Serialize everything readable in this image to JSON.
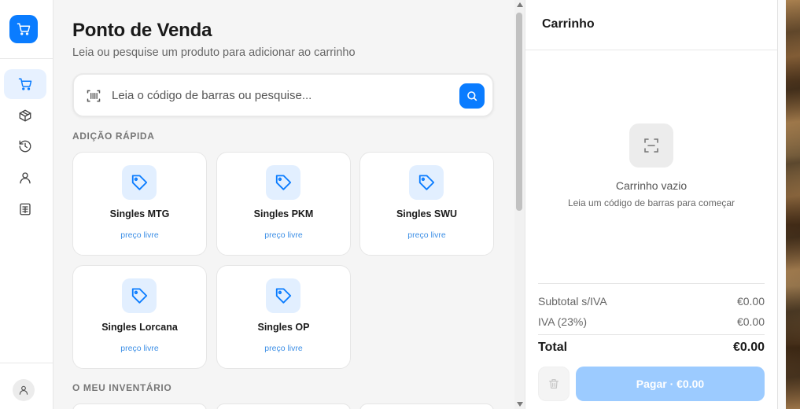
{
  "sidebar": {
    "logo_icon": "cart-icon",
    "nav": [
      {
        "name": "pos",
        "icon": "cart-icon",
        "active": true
      },
      {
        "name": "products",
        "icon": "box-icon",
        "active": false
      },
      {
        "name": "history",
        "icon": "history-icon",
        "active": false
      },
      {
        "name": "customers",
        "icon": "user-icon",
        "active": false
      },
      {
        "name": "reports",
        "icon": "spreadsheet-icon",
        "active": false
      }
    ],
    "user_icon": "user-icon"
  },
  "main": {
    "title": "Ponto de Venda",
    "subtitle": "Leia ou pesquise um produto para adicionar ao carrinho",
    "search": {
      "placeholder": "Leia o código de barras ou pesquise...",
      "value": ""
    },
    "quick_add": {
      "heading": "ADIÇÃO RÁPIDA",
      "items": [
        {
          "name": "Singles MTG",
          "price": "preço livre"
        },
        {
          "name": "Singles PKM",
          "price": "preço livre"
        },
        {
          "name": "Singles SWU",
          "price": "preço livre"
        },
        {
          "name": "Singles Lorcana",
          "price": "preço livre"
        },
        {
          "name": "Singles OP",
          "price": "preço livre"
        }
      ]
    },
    "inventory": {
      "heading": "O MEU INVENTÁRIO"
    }
  },
  "cart": {
    "title": "Carrinho",
    "empty_title": "Carrinho vazio",
    "empty_subtitle": "Leia um código de barras para começar",
    "subtotal_label": "Subtotal s/IVA",
    "subtotal_value": "€0.00",
    "vat_label": "IVA (23%)",
    "vat_value": "€0.00",
    "total_label": "Total",
    "total_value": "€0.00",
    "pay_label": "Pagar · €0.00"
  },
  "colors": {
    "accent": "#0a7cff",
    "accent_light": "#e2efff",
    "pay_disabled": "#9ccbff",
    "price_text": "#3d8fe6"
  }
}
